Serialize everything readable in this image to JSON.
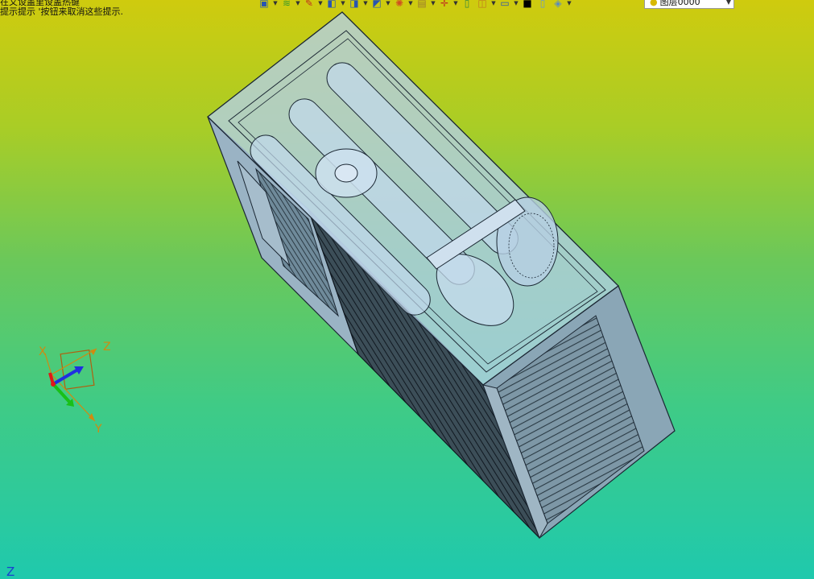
{
  "hints": {
    "line1": "在又设盖里设盖热键",
    "line2": "提示提示 '按钮来取消这些提示."
  },
  "toolbar": {
    "icons": [
      "new-part-icon",
      "layers-icon",
      "sketch-icon",
      "solid-box-icon",
      "primitive-icon",
      "shell-icon",
      "render-icon",
      "clipboard-icon",
      "transform-icon",
      "document-icon",
      "frame-icon",
      "monitor-icon",
      "color-swatch-icon",
      "sheet-icon",
      "stack-icon"
    ],
    "layer_select": "图层0000"
  },
  "triad": {
    "x_label": "X",
    "y_label": "Y",
    "z_label": "Z"
  },
  "view_label": "Z",
  "colors": {
    "bg_top": "#cfcb0e",
    "bg_bottom": "#1fc9ad",
    "model_glass": "#a9c8e8",
    "model_line": "#1b2733"
  }
}
